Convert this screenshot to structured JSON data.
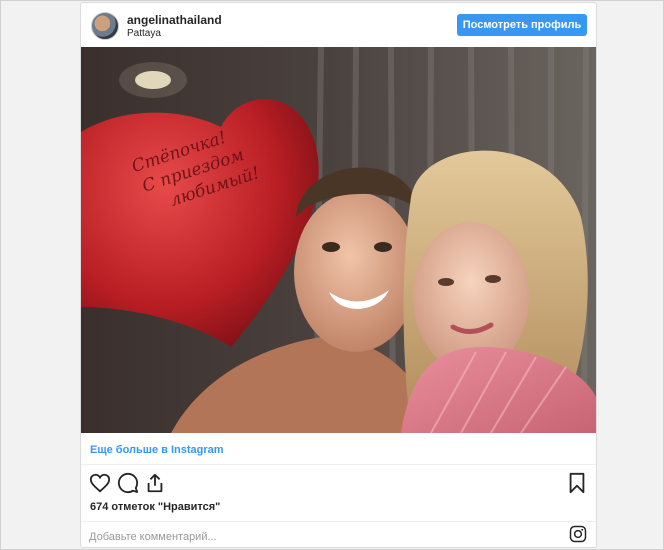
{
  "post": {
    "username": "angelinathailand",
    "location": "Pattaya",
    "view_profile_label": "Посмотреть профиль",
    "more_link_label": "Еще больше в Instagram",
    "likes_text": "674 отметок \"Нравится\"",
    "comment_placeholder": "Добавьте комментарий..."
  },
  "photo": {
    "balloon_text": [
      "Стёпочка!",
      "С приездом",
      "любимый!"
    ]
  },
  "icons": {
    "like": "heart-icon",
    "comment": "comment-icon",
    "share": "share-icon",
    "save": "bookmark-icon",
    "brand": "instagram-icon"
  },
  "colors": {
    "accent": "#3897f0",
    "text": "#262626",
    "balloon": "#c0262b"
  }
}
